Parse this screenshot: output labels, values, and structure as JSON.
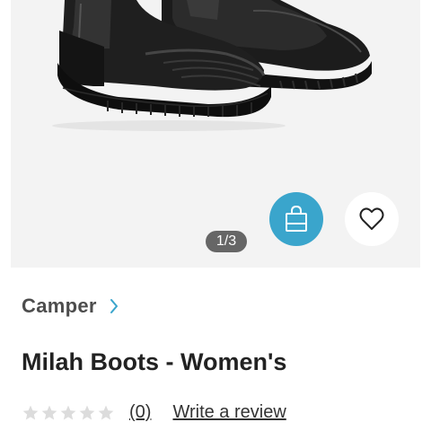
{
  "gallery": {
    "image_name": "black leather chelsea boots",
    "counter": "1/3"
  },
  "actions": {
    "bag_icon": "shopping-bag-icon",
    "favorite_icon": "heart-icon",
    "accent_color": "#3aa5cc"
  },
  "product": {
    "brand": "Camper",
    "title": "Milah Boots - Women's"
  },
  "rating": {
    "stars_filled": 0,
    "stars_total": 5,
    "count_label": "(0)",
    "write_review_label": "Write a review"
  }
}
